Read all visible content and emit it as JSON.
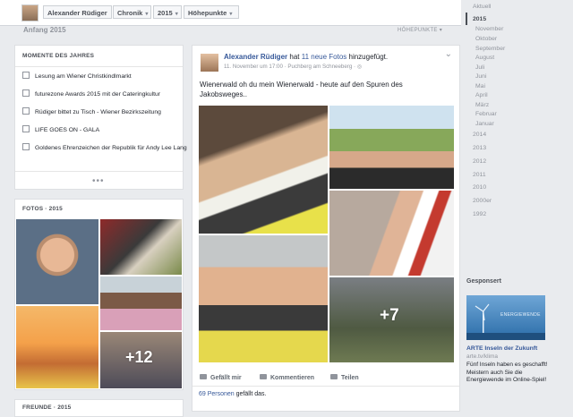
{
  "topbar": {
    "profile_name": "Alexander Rüdiger",
    "chronik": "Chronik",
    "year": "2015",
    "highlights": "Höhepunkte",
    "dropdown_glyph": "▾"
  },
  "section": {
    "title": "Anfang 2015",
    "right_label": "HÖHEPUNKTE",
    "right_glyph": "▾"
  },
  "moments": {
    "header": "MOMENTE DES JAHRES",
    "items": [
      {
        "label": "Lesung am Wiener Christkindlmarkt"
      },
      {
        "label": "futurezone Awards 2015 mit der Cateringkultur"
      },
      {
        "label": "Rüdiger bittet zu Tisch - Wiener Bezirkszeitung"
      },
      {
        "label": "LIFE GOES ON - GALA"
      },
      {
        "label": "Goldenes Ehrenzeichen der Republik für Andy Lee Lang"
      }
    ],
    "more": "•••"
  },
  "photos": {
    "header": "FOTOS · 2015",
    "more_count": "+12"
  },
  "friends": {
    "header": "FREUNDE · 2015"
  },
  "post": {
    "author": "Alexander Rüdiger",
    "action_prefix": " hat ",
    "action_link": "11 neue Fotos",
    "action_suffix": " hinzugefügt.",
    "meta": "11. November um 17:00 · Puchberg am Schneeberg · ",
    "globe_icon": "◎",
    "menu_glyph": "⌄",
    "text": "Wienerwald oh du mein Wienerwald - heute auf den Spuren des Jakobsweges..",
    "more_count": "+7",
    "actions": {
      "like": "Gefällt mir",
      "comment": "Kommentieren",
      "share": "Teilen"
    },
    "likes_link": "69 Personen",
    "likes_suffix": " gefällt das."
  },
  "year_nav": {
    "current": "Aktuell",
    "active_year": "2015",
    "months": [
      "November",
      "Oktober",
      "September",
      "August",
      "Juli",
      "Juni",
      "Mai",
      "April",
      "März",
      "Februar",
      "Januar"
    ],
    "years": [
      "2014",
      "2013",
      "2012",
      "2011",
      "2010",
      "2000er",
      "1992"
    ]
  },
  "ad": {
    "section": "Gesponsert",
    "image_text": "ENERGIEWENDE",
    "title": "ARTE Inseln der Zukunft",
    "url": "arte.tv/klima",
    "text": "Fünf Inseln haben es geschafft! Meistern auch Sie die Energiewende im Online-Spiel!"
  },
  "colors": {
    "link": "#365899",
    "background": "#e9ebee",
    "muted": "#90949c"
  }
}
